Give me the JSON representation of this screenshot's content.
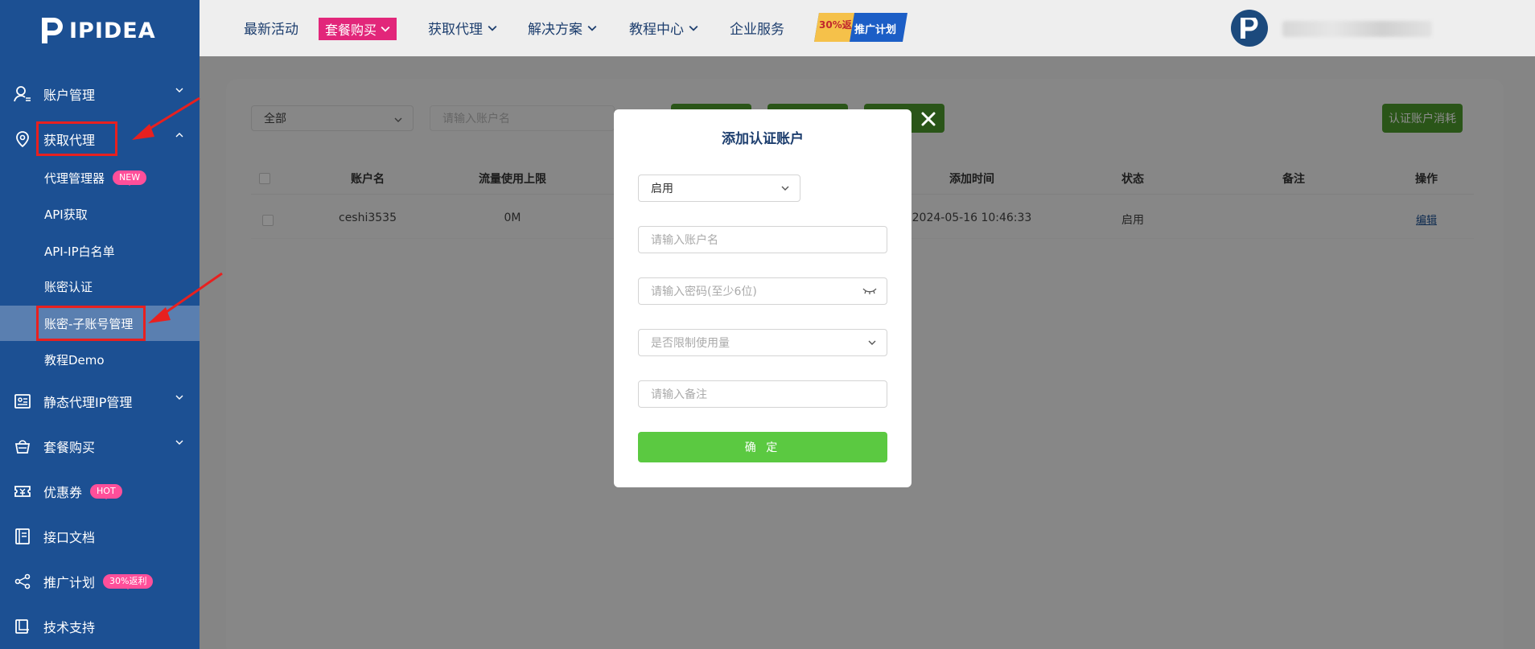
{
  "brand": {
    "name": "IPIDEA"
  },
  "sidebar": {
    "items": [
      {
        "label": "账户管理"
      },
      {
        "label": "获取代理"
      },
      {
        "label": "代理管理器",
        "tag": "NEW"
      },
      {
        "label": "API获取"
      },
      {
        "label": "API-IP白名单"
      },
      {
        "label": "账密认证"
      },
      {
        "label": "账密-子账号管理"
      },
      {
        "label": "教程Demo"
      },
      {
        "label": "静态代理IP管理"
      },
      {
        "label": "套餐购买"
      },
      {
        "label": "优惠券",
        "tag": "HOT"
      },
      {
        "label": "接口文档"
      },
      {
        "label": "推广计划",
        "tag": "30%返利"
      },
      {
        "label": "技术支持"
      }
    ]
  },
  "header": {
    "links": [
      "最新活动",
      "套餐购买",
      "获取代理",
      "解决方案",
      "教程中心",
      "企业服务"
    ],
    "promo_top": "30%返",
    "promo_bottom": "推广计划"
  },
  "toolbar": {
    "filter_value": "全部",
    "search_placeholder": "请输入账户名",
    "right_button": "认证账户消耗"
  },
  "table": {
    "headers": [
      "账户名",
      "流量使用上限",
      "添加时间",
      "状态",
      "备注",
      "操作"
    ],
    "rows": [
      {
        "account": "ceshi3535",
        "limit": "0M",
        "time": "2024-05-16 10:46:33",
        "status": "启用",
        "remark": "",
        "action": "编辑"
      }
    ]
  },
  "modal": {
    "title": "添加认证账户",
    "status_value": "启用",
    "account_placeholder": "请输入账户名",
    "password_placeholder": "请输入密码(至少6位)",
    "limit_placeholder": "是否限制使用量",
    "remark_placeholder": "请输入备注",
    "confirm_label": "确 定"
  },
  "colors": {
    "sidebar_bg": "#1c5093",
    "active_item": "#5a7fb0",
    "green": "#5bc941",
    "tag_pink": "#ff4f9a"
  }
}
